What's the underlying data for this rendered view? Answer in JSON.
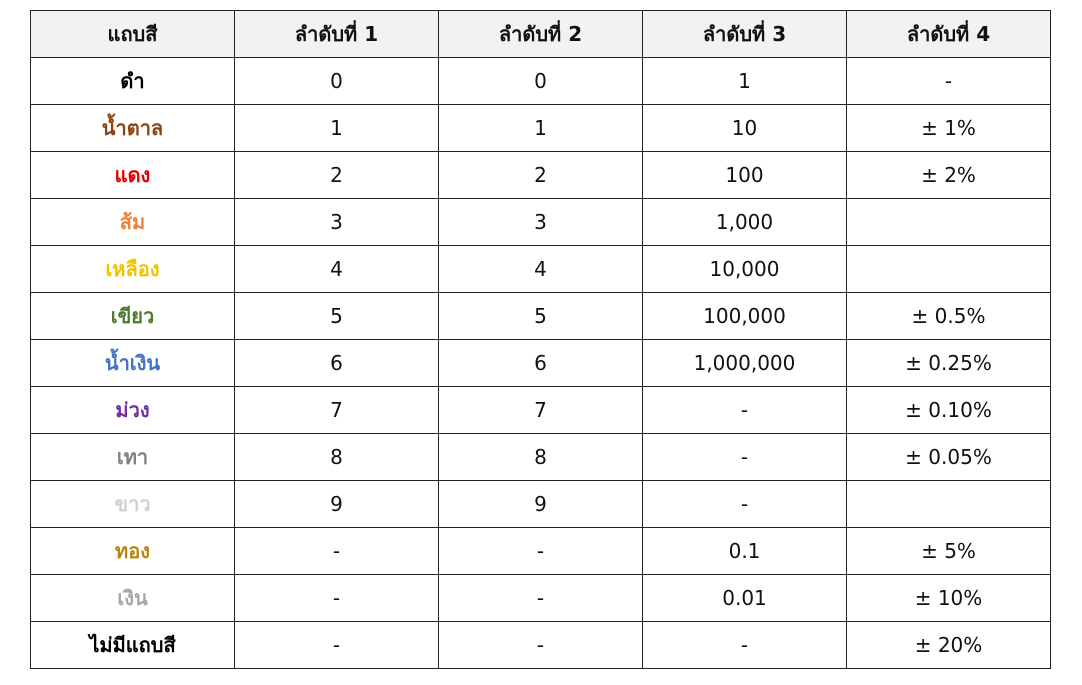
{
  "table": {
    "headers": [
      "แถบสี",
      "ลำดับที่ 1",
      "ลำดับที่ 2",
      "ลำดับที่ 3",
      "ลำดับที่ 4"
    ],
    "rows": [
      {
        "name": "ดำ",
        "color": "#000000",
        "v1": "0",
        "v2": "0",
        "v3": "1",
        "v4": "-"
      },
      {
        "name": "น้ำตาล",
        "color": "#8B4513",
        "v1": "1",
        "v2": "1",
        "v3": "10",
        "v4": "± 1%"
      },
      {
        "name": "แดง",
        "color": "#E00000",
        "v1": "2",
        "v2": "2",
        "v3": "100",
        "v4": "± 2%"
      },
      {
        "name": "ส้ม",
        "color": "#E8853A",
        "v1": "3",
        "v2": "3",
        "v3": "1,000",
        "v4": ""
      },
      {
        "name": "เหลือง",
        "color": "#F2C200",
        "v1": "4",
        "v2": "4",
        "v3": "10,000",
        "v4": ""
      },
      {
        "name": "เขียว",
        "color": "#4E7A2E",
        "v1": "5",
        "v2": "5",
        "v3": "100,000",
        "v4": "± 0.5%"
      },
      {
        "name": "น้ำเงิน",
        "color": "#4472C4",
        "v1": "6",
        "v2": "6",
        "v3": "1,000,000",
        "v4": "± 0.25%"
      },
      {
        "name": "ม่วง",
        "color": "#7030A0",
        "v1": "7",
        "v2": "7",
        "v3": "-",
        "v4": "± 0.10%"
      },
      {
        "name": "เทา",
        "color": "#808080",
        "v1": "8",
        "v2": "8",
        "v3": "-",
        "v4": "± 0.05%"
      },
      {
        "name": "ขาว",
        "color": "#D0D0D0",
        "v1": "9",
        "v2": "9",
        "v3": "-",
        "v4": ""
      },
      {
        "name": "ทอง",
        "color": "#B8860B",
        "v1": "-",
        "v2": "-",
        "v3": "0.1",
        "v4": "± 5%"
      },
      {
        "name": "เงิน",
        "color": "#A6A6A6",
        "v1": "-",
        "v2": "-",
        "v3": "0.01",
        "v4": "± 10%"
      },
      {
        "name": "ไม่มีแถบสี",
        "color": "#000000",
        "v1": "-",
        "v2": "-",
        "v3": "-",
        "v4": "± 20%"
      }
    ]
  }
}
